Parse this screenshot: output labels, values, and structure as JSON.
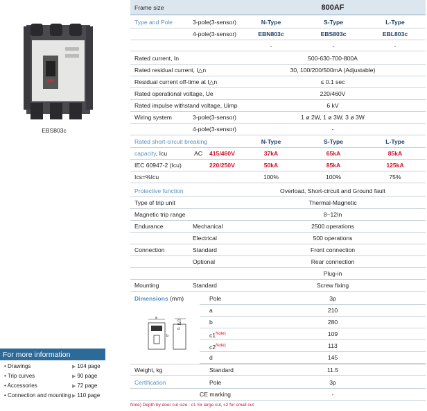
{
  "product": {
    "label": "EBS803c"
  },
  "info": {
    "title": "For more information",
    "items": [
      {
        "label": "• Drawings",
        "page": "104 page"
      },
      {
        "label": "• Trip curves",
        "page": "90 page"
      },
      {
        "label": "• Accessories",
        "page": "72 page"
      },
      {
        "label": "• Connection and mounting",
        "page": "110 page"
      }
    ]
  },
  "table": {
    "frame": {
      "label": "Frame size",
      "value": "800AF"
    },
    "type_pole": {
      "label": "Type and Pole",
      "p3": "3-pole(3-sensor)",
      "p4": "4-pole(3-sensor)",
      "types": [
        "N-Type",
        "S-Type",
        "L-Type"
      ],
      "models": [
        "EBN803c",
        "EBS803c",
        "EBL803c"
      ],
      "dash": [
        "-",
        "-",
        "-"
      ]
    },
    "rated_current": {
      "label": "Rated current, In",
      "value": "500-630-700-800A"
    },
    "residual_current": {
      "label": "Rated residual current, I△n",
      "value": "30, 100/200/500mA (Adjustable)"
    },
    "offtime": {
      "label": "Residual current off-time at I△n",
      "value": "≤ 0.1 sec"
    },
    "voltage": {
      "label": "Rated operational voltage, Ue",
      "value": "220/460V"
    },
    "impulse": {
      "label": "Rated impulse withstand voltage, Uimp",
      "value": "6 kV"
    },
    "wiring": {
      "label": "Wiring system",
      "p3": "3-pole(3-sensor)",
      "v3": "1 ø 2W, 1 ø 3W, 3 ø 3W",
      "p4": "4-pole(3-sensor)",
      "v4": "-"
    },
    "short_circuit": {
      "label1": "Rated short-circuit breaking",
      "label2": "capacity",
      "label2b": ", Icu",
      "label3": "IEC 60947-2 (Icu)",
      "ac": "AC",
      "v1": "415/460V",
      "v2": "220/250V",
      "types": [
        "N-Type",
        "S-Type",
        "L-Type"
      ],
      "r1": [
        "37kA",
        "65kA",
        "85kA"
      ],
      "r2": [
        "50kA",
        "85kA",
        "125kA"
      ],
      "ics_label": "Ics=%Icu",
      "ics": [
        "100%",
        "100%",
        "75%"
      ]
    },
    "protective": {
      "label": "Protective function",
      "value": "Overload, Short-circuit and Ground fault"
    },
    "trip_unit": {
      "label": "Type of trip unit",
      "value": "Thermal-Magnetic"
    },
    "magnetic": {
      "label": "Magnetic trip range",
      "value": "8~12In"
    },
    "endurance": {
      "label": "Endurance",
      "mech": "Mechanical",
      "mech_v": "2500 operations",
      "elec": "Electrical",
      "elec_v": "500 operations"
    },
    "connection": {
      "label": "Connection",
      "std": "Standard",
      "std_v": "Front connection",
      "opt": "Optional",
      "opt_v": "Rear connection",
      "opt_v2": "Plug-in"
    },
    "mounting": {
      "label": "Mounting",
      "std": "Standard",
      "value": "Screw fixing"
    },
    "dimensions": {
      "label": "Dimensions",
      "unit": "(mm)",
      "note_sup": "Note)",
      "rows": [
        {
          "k": "Pole",
          "v": "3p"
        },
        {
          "k": "a",
          "v": "210"
        },
        {
          "k": "b",
          "v": "280"
        },
        {
          "k": "c1",
          "v": "109"
        },
        {
          "k": "c2",
          "v": "113"
        },
        {
          "k": "d",
          "v": "145"
        }
      ],
      "drawing_labels": {
        "a": "a",
        "b": "b",
        "c1": "c1",
        "c2": "c2",
        "d": "d"
      }
    },
    "weight": {
      "label": "Weight, kg",
      "std": "Standard",
      "value": "11.5"
    },
    "certification": {
      "label": "Certification",
      "pole": "Pole",
      "pole_v": "3p",
      "ce": "CE marking",
      "ce_v": "-"
    }
  },
  "footnote": "Note) Depth by door cut size : c1 for large cut, c2 for small cut",
  "colors": {
    "header_bg": "#dbe6ef",
    "accent": "#2c6a98",
    "section": "#5a8fbf",
    "red": "#d4102a",
    "grid": "#c9d2da"
  }
}
